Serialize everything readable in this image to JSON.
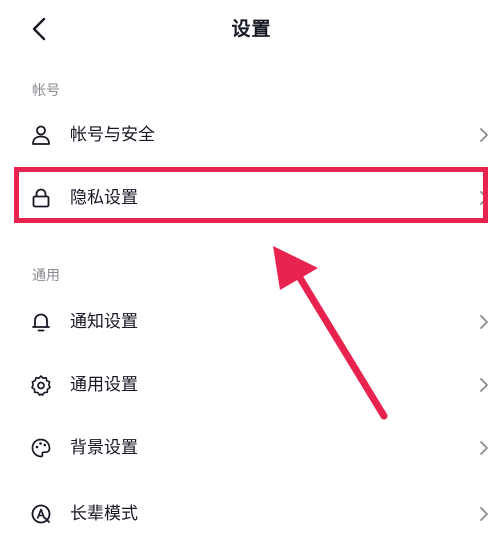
{
  "header": {
    "title": "设置"
  },
  "sections": {
    "account": {
      "label": "帐号",
      "items": [
        {
          "label": "帐号与安全",
          "icon": "user-icon"
        },
        {
          "label": "隐私设置",
          "icon": "lock-icon"
        }
      ]
    },
    "general": {
      "label": "通用",
      "items": [
        {
          "label": "通知设置",
          "icon": "bell-icon"
        },
        {
          "label": "通用设置",
          "icon": "gear-icon"
        },
        {
          "label": "背景设置",
          "icon": "palette-icon"
        },
        {
          "label": "长辈模式",
          "icon": "elder-mode-icon"
        }
      ]
    }
  },
  "colors": {
    "highlight": "#e8234f",
    "text": "#161823",
    "muted": "#8a8b91",
    "chevron": "#8a8b91"
  }
}
